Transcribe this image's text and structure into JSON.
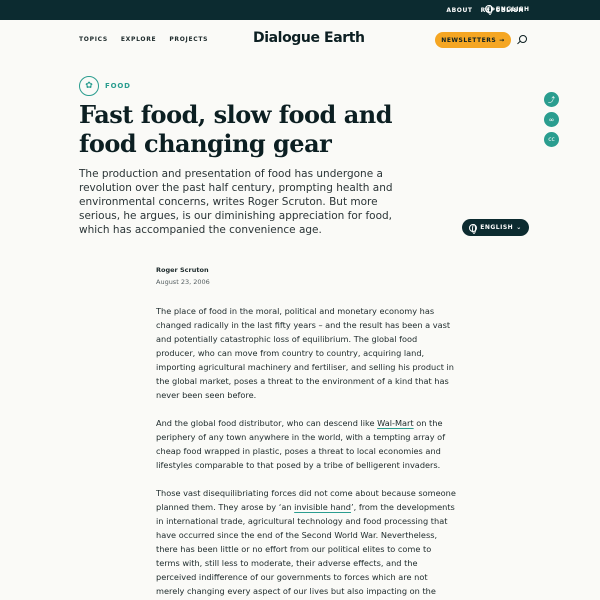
{
  "topbar": {
    "about": "ABOUT",
    "republish": "REPUBLISH",
    "language": "ENGLISH"
  },
  "nav": {
    "topics": "TOPICS",
    "explore": "EXPLORE",
    "projects": "PROJECTS",
    "newsletters": "NEWSLETTERS"
  },
  "brand": {
    "name": "Dialogue Earth"
  },
  "article": {
    "topic": "FOOD",
    "title": "Fast food, slow food and food changing gear",
    "standfirst": "The production and presentation of food has undergone a revolution over the past half century, prompting health and environmental concerns, writes Roger Scruton. But more serious, he argues, is our diminishing appreciation for food, which has accompanied the convenience age.",
    "language_pill": "ENGLISH",
    "author": "Roger Scruton",
    "date": "August 23, 2006",
    "p1": "The place of food in the moral, political and monetary economy has changed radically in the last fifty years – and the result has been a vast and potentially catastrophic loss of equilibrium. The global food producer, who can move from country to country, acquiring land, importing agricultural machinery and fertiliser, and selling his product in the global market, poses a threat to the environment of a kind that has never been seen before.",
    "p2_before": "And the global food distributor, who can descend like ",
    "p2_link": "Wal-Mart",
    "p2_after": " on the periphery of any town anywhere in the world, with a tempting array of cheap food wrapped in plastic, poses a threat to local economies and lifestyles comparable to that posed by a tribe of belligerent invaders.",
    "p3_before": "Those vast disequilibriating forces did not come about because someone planned them. They arose by ‘an ",
    "p3_link": "invisible hand",
    "p3_after": "’, from the developments in international trade, agricultural technology and food processing that have occurred since the end of the Second World War. Nevertheless, there has been little or no effort from our political elites to come to terms with, still less to moderate, their adverse effects, and the perceived indifference of our governments to forces which are not merely changing every aspect of our lives but also impacting on the"
  },
  "colors": {
    "dark": "#0c2b30",
    "accent": "#2a9d8f",
    "newsletter": "#f5a623"
  },
  "icons": {
    "share": "share-icon",
    "link": "link-icon",
    "license": "cc-icon",
    "search": "search-icon",
    "globe": "globe-icon",
    "topic": "food-icon"
  }
}
